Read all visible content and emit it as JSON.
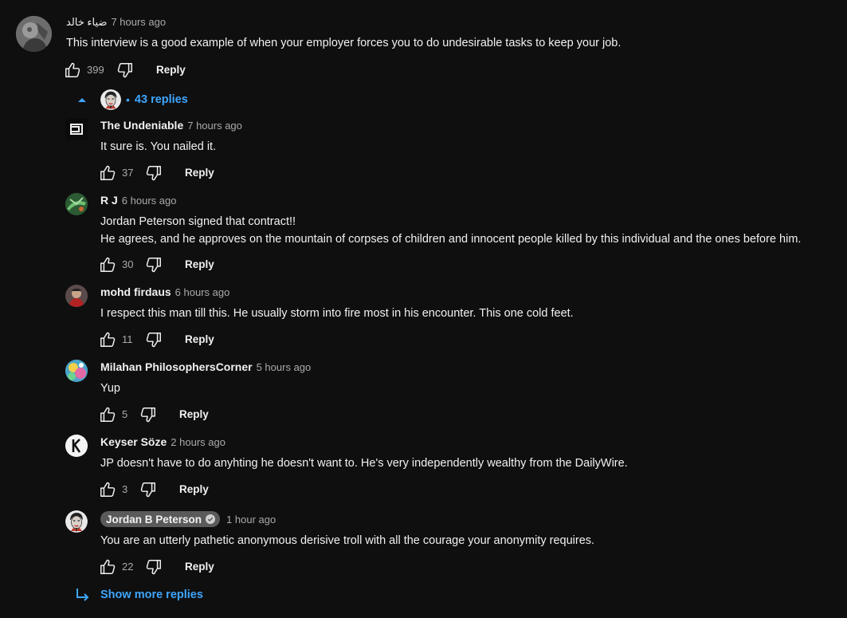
{
  "top_comment": {
    "author": "ضياء خالد",
    "time": "7 hours ago",
    "text": "This interview is a good example of when your employer forces you to do undesirable tasks to keep your job.",
    "likes": "399",
    "reply_label": "Reply"
  },
  "replies_toggle": {
    "bullet": "•",
    "label": "43 replies"
  },
  "replies": [
    {
      "author": "The Undeniable",
      "time": "7 hours ago",
      "lines": [
        "It sure is. You nailed it."
      ],
      "likes": "37",
      "reply_label": "Reply"
    },
    {
      "author": "R J",
      "time": "6 hours ago",
      "lines": [
        "Jordan Peterson signed that contract!!",
        "He agrees, and he approves on the mountain of corpses of children and innocent people killed by this individual and the ones before him."
      ],
      "likes": "30",
      "reply_label": "Reply"
    },
    {
      "author": "mohd firdaus",
      "time": "6 hours ago",
      "lines": [
        "I respect this man till this. He usually storm into fire most in his encounter. This one cold feet."
      ],
      "likes": "11",
      "reply_label": "Reply"
    },
    {
      "author": "Milahan PhilosophersCorner",
      "time": "5 hours ago",
      "lines": [
        "Yup"
      ],
      "likes": "5",
      "reply_label": "Reply"
    },
    {
      "author": "Keyser Söze",
      "time": "2 hours ago",
      "lines": [
        "JP doesn't have to do anyhting he doesn't want to. He's very independently wealthy from  the DailyWire."
      ],
      "likes": "3",
      "reply_label": "Reply"
    },
    {
      "author": "Jordan B Peterson",
      "time": "1 hour ago",
      "lines": [
        "You are an utterly pathetic anonymous derisive troll with all the courage your anonymity requires."
      ],
      "likes": "22",
      "reply_label": "Reply"
    }
  ],
  "show_more": {
    "label": "Show more replies"
  },
  "colors": {
    "background": "#0f0f0f",
    "text": "#f1f1f1",
    "secondary": "#aaaaaa",
    "link_blue": "#3ea6ff",
    "owner_badge": "#5a5a5a"
  },
  "icons": {
    "like": "thumbs-up-icon",
    "dislike": "thumbs-down-icon",
    "collapse": "caret-up-icon",
    "show_more": "reply-arrow-icon",
    "verified": "check-circle-icon"
  }
}
